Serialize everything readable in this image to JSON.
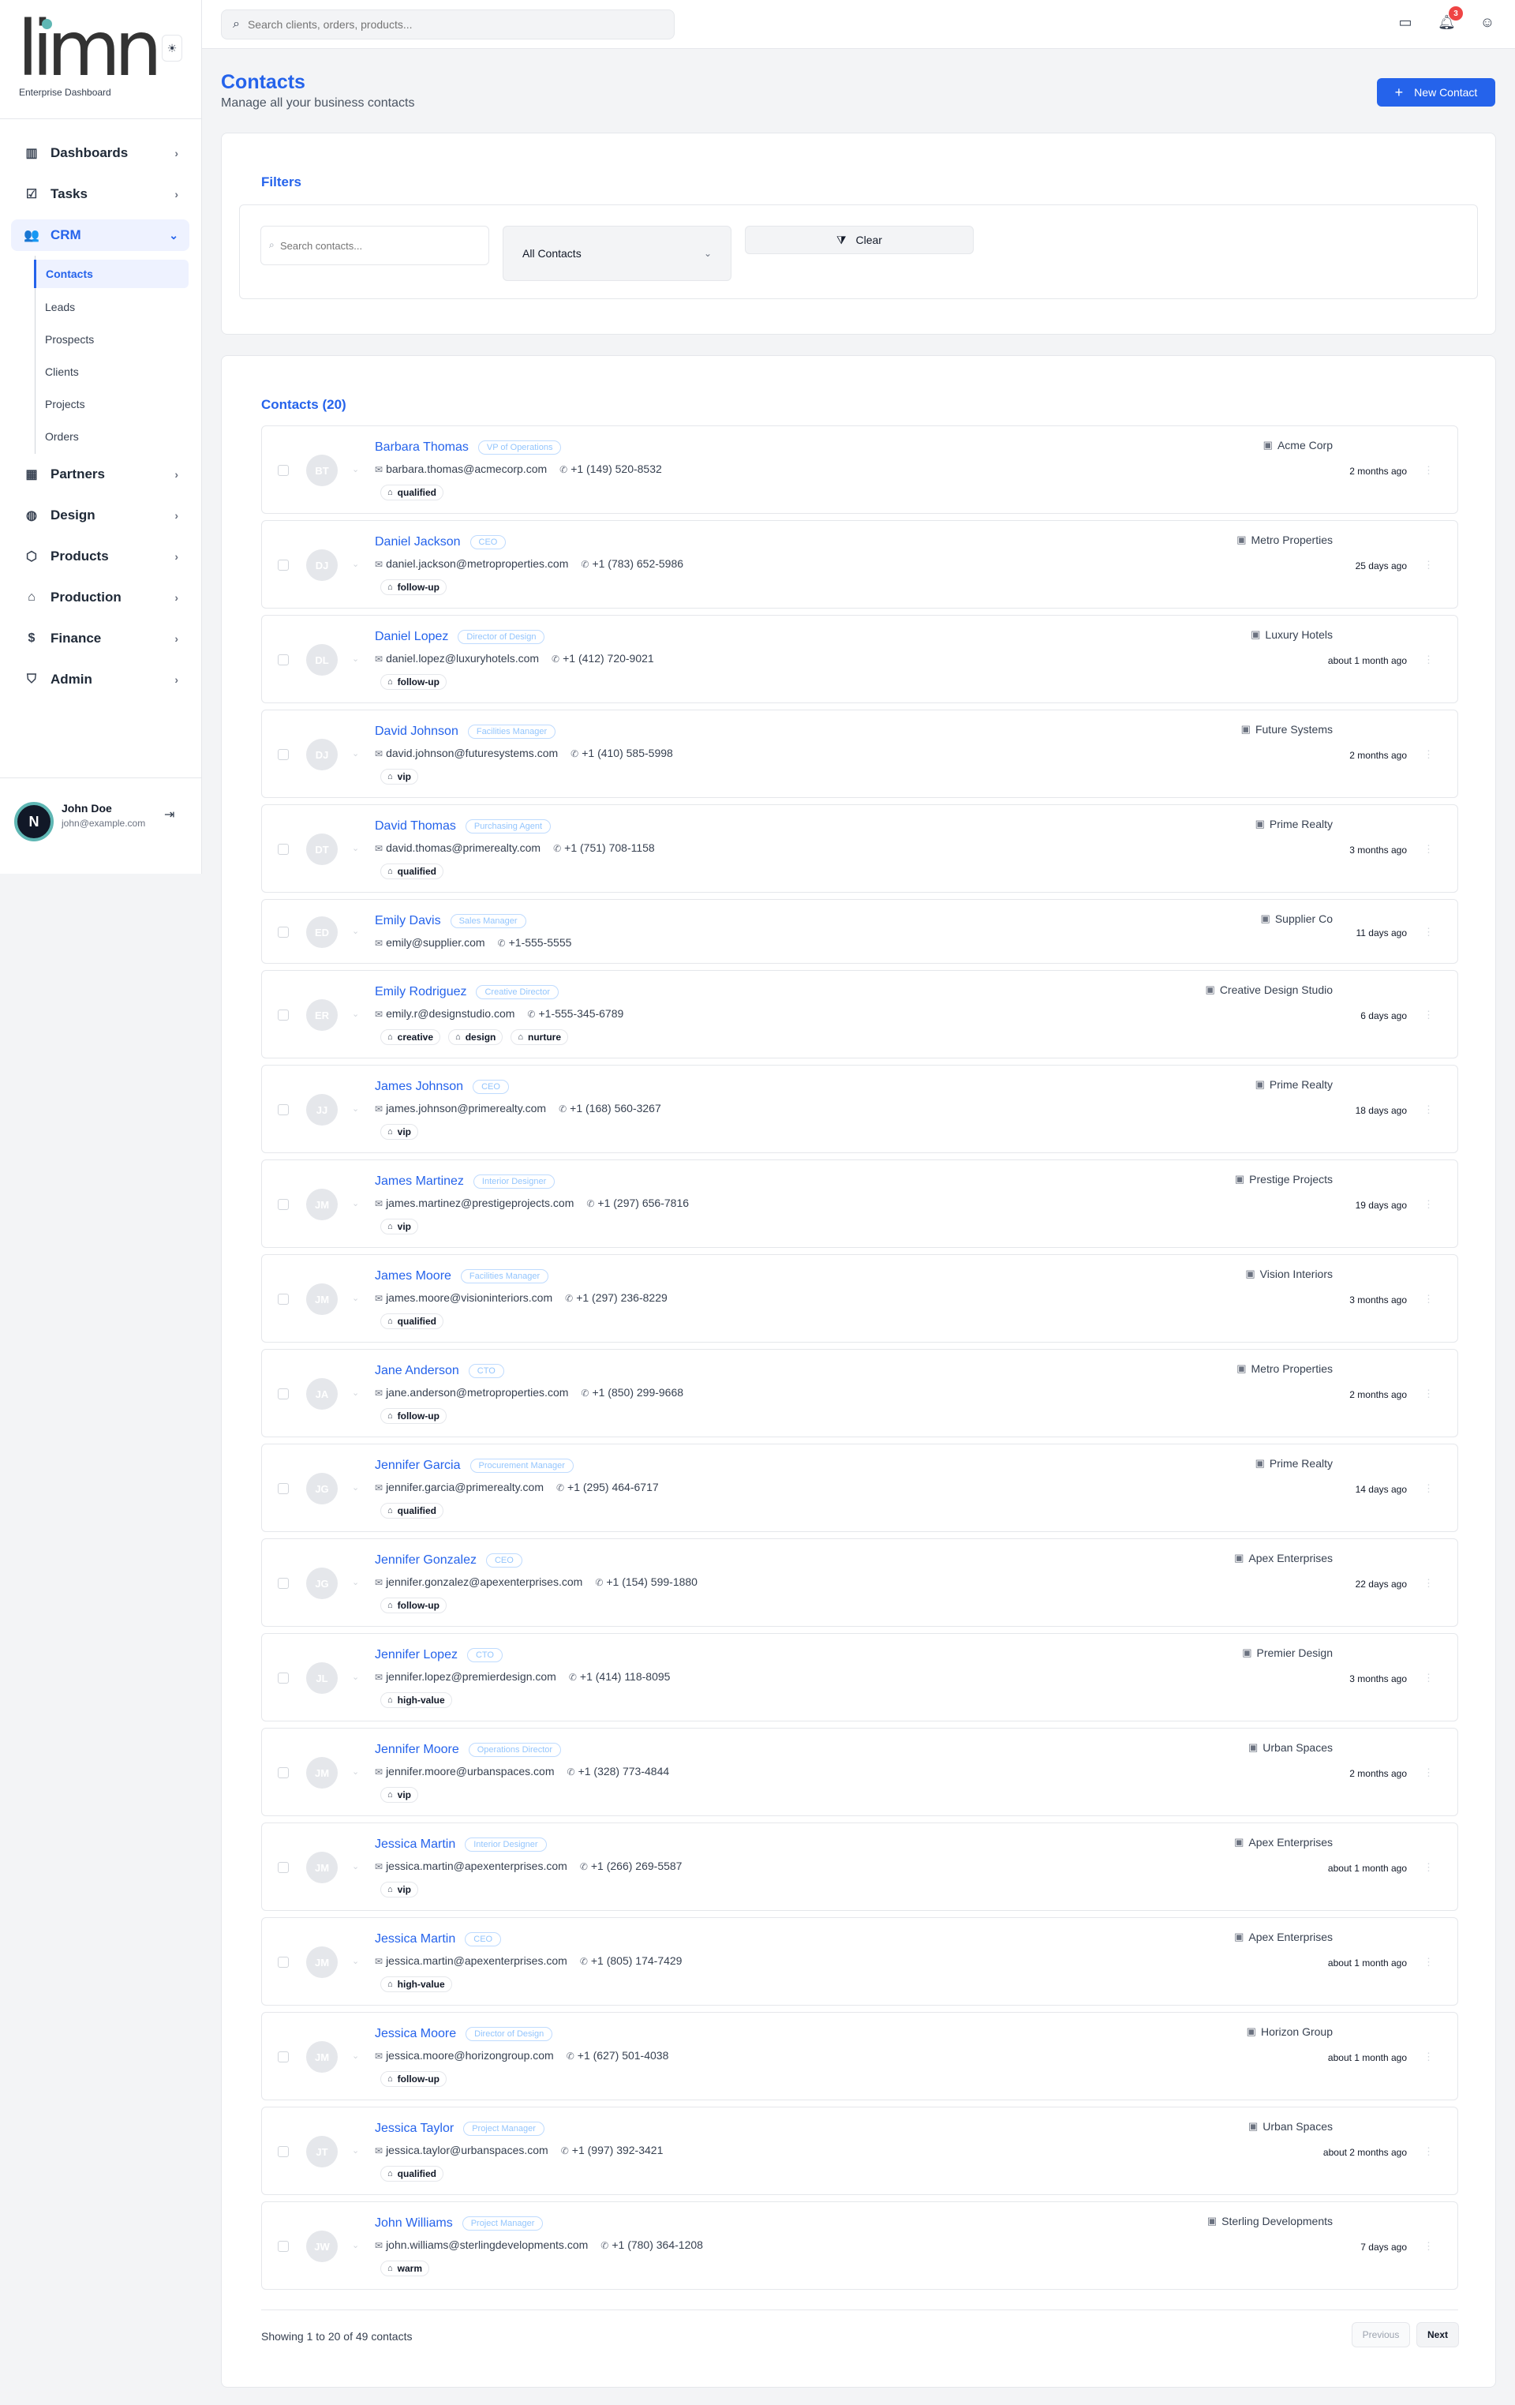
{
  "brand": {
    "logo_text": "limn",
    "subtitle": "Enterprise Dashboard",
    "theme_icon": "sun-icon"
  },
  "search": {
    "placeholder": "Search clients, orders, products..."
  },
  "header": {
    "notification_count": "3"
  },
  "sidebar": {
    "items": [
      {
        "label": "Dashboards",
        "icon": "bar-chart-icon"
      },
      {
        "label": "Tasks",
        "icon": "checkbox-icon"
      },
      {
        "label": "CRM",
        "icon": "users-icon",
        "active": true
      },
      {
        "label": "Partners",
        "icon": "building-icon"
      },
      {
        "label": "Design",
        "icon": "palette-icon"
      },
      {
        "label": "Products",
        "icon": "box-icon"
      },
      {
        "label": "Production",
        "icon": "factory-icon"
      },
      {
        "label": "Finance",
        "icon": "dollar-icon"
      },
      {
        "label": "Admin",
        "icon": "shield-icon"
      }
    ],
    "crm_sub": [
      "Contacts",
      "Leads",
      "Prospects",
      "Clients",
      "Projects",
      "Orders"
    ],
    "user": {
      "initial": "N",
      "name": "John Doe",
      "email": "john@example.com"
    }
  },
  "page": {
    "title": "Contacts",
    "subtitle": "Manage all your business contacts",
    "new_button": "New Contact"
  },
  "filters": {
    "title": "Filters",
    "search_placeholder": "Search contacts...",
    "select_value": "All Contacts",
    "clear_label": "Clear"
  },
  "contacts": {
    "title": "Contacts (20)",
    "rows": [
      {
        "initials": "BT",
        "name": "Barbara Thomas",
        "role": "VP of Operations",
        "email": "barbara.thomas@acmecorp.com",
        "phone": "+1 (149) 520-8532",
        "tags": [
          "qualified"
        ],
        "company": "Acme Corp",
        "time": "2 months ago"
      },
      {
        "initials": "DJ",
        "name": "Daniel Jackson",
        "role": "CEO",
        "email": "daniel.jackson@metroproperties.com",
        "phone": "+1 (783) 652-5986",
        "tags": [
          "follow-up"
        ],
        "company": "Metro Properties",
        "time": "25 days ago"
      },
      {
        "initials": "DL",
        "name": "Daniel Lopez",
        "role": "Director of Design",
        "email": "daniel.lopez@luxuryhotels.com",
        "phone": "+1 (412) 720-9021",
        "tags": [
          "follow-up"
        ],
        "company": "Luxury Hotels",
        "time": "about 1 month ago"
      },
      {
        "initials": "DJ",
        "name": "David Johnson",
        "role": "Facilities Manager",
        "email": "david.johnson@futuresystems.com",
        "phone": "+1 (410) 585-5998",
        "tags": [
          "vip"
        ],
        "company": "Future Systems",
        "time": "2 months ago"
      },
      {
        "initials": "DT",
        "name": "David Thomas",
        "role": "Purchasing Agent",
        "email": "david.thomas@primerealty.com",
        "phone": "+1 (751) 708-1158",
        "tags": [
          "qualified"
        ],
        "company": "Prime Realty",
        "time": "3 months ago"
      },
      {
        "initials": "ED",
        "name": "Emily Davis",
        "role": "Sales Manager",
        "email": "emily@supplier.com",
        "phone": "+1-555-5555",
        "tags": [],
        "company": "Supplier Co",
        "time": "11 days ago"
      },
      {
        "initials": "ER",
        "name": "Emily Rodriguez",
        "role": "Creative Director",
        "email": "emily.r@designstudio.com",
        "phone": "+1-555-345-6789",
        "tags": [
          "creative",
          "design",
          "nurture"
        ],
        "company": "Creative Design Studio",
        "time": "6 days ago"
      },
      {
        "initials": "JJ",
        "name": "James Johnson",
        "role": "CEO",
        "email": "james.johnson@primerealty.com",
        "phone": "+1 (168) 560-3267",
        "tags": [
          "vip"
        ],
        "company": "Prime Realty",
        "time": "18 days ago"
      },
      {
        "initials": "JM",
        "name": "James Martinez",
        "role": "Interior Designer",
        "email": "james.martinez@prestigeprojects.com",
        "phone": "+1 (297) 656-7816",
        "tags": [
          "vip"
        ],
        "company": "Prestige Projects",
        "time": "19 days ago"
      },
      {
        "initials": "JM",
        "name": "James Moore",
        "role": "Facilities Manager",
        "email": "james.moore@visioninteriors.com",
        "phone": "+1 (297) 236-8229",
        "tags": [
          "qualified"
        ],
        "company": "Vision Interiors",
        "time": "3 months ago"
      },
      {
        "initials": "JA",
        "name": "Jane Anderson",
        "role": "CTO",
        "email": "jane.anderson@metroproperties.com",
        "phone": "+1 (850) 299-9668",
        "tags": [
          "follow-up"
        ],
        "company": "Metro Properties",
        "time": "2 months ago"
      },
      {
        "initials": "JG",
        "name": "Jennifer Garcia",
        "role": "Procurement Manager",
        "email": "jennifer.garcia@primerealty.com",
        "phone": "+1 (295) 464-6717",
        "tags": [
          "qualified"
        ],
        "company": "Prime Realty",
        "time": "14 days ago"
      },
      {
        "initials": "JG",
        "name": "Jennifer Gonzalez",
        "role": "CEO",
        "email": "jennifer.gonzalez@apexenterprises.com",
        "phone": "+1 (154) 599-1880",
        "tags": [
          "follow-up"
        ],
        "company": "Apex Enterprises",
        "time": "22 days ago"
      },
      {
        "initials": "JL",
        "name": "Jennifer Lopez",
        "role": "CTO",
        "email": "jennifer.lopez@premierdesign.com",
        "phone": "+1 (414) 118-8095",
        "tags": [
          "high-value"
        ],
        "company": "Premier Design",
        "time": "3 months ago"
      },
      {
        "initials": "JM",
        "name": "Jennifer Moore",
        "role": "Operations Director",
        "email": "jennifer.moore@urbanspaces.com",
        "phone": "+1 (328) 773-4844",
        "tags": [
          "vip"
        ],
        "company": "Urban Spaces",
        "time": "2 months ago"
      },
      {
        "initials": "JM",
        "name": "Jessica Martin",
        "role": "Interior Designer",
        "email": "jessica.martin@apexenterprises.com",
        "phone": "+1 (266) 269-5587",
        "tags": [
          "vip"
        ],
        "company": "Apex Enterprises",
        "time": "about 1 month ago"
      },
      {
        "initials": "JM",
        "name": "Jessica Martin",
        "role": "CEO",
        "email": "jessica.martin@apexenterprises.com",
        "phone": "+1 (805) 174-7429",
        "tags": [
          "high-value"
        ],
        "company": "Apex Enterprises",
        "time": "about 1 month ago"
      },
      {
        "initials": "JM",
        "name": "Jessica Moore",
        "role": "Director of Design",
        "email": "jessica.moore@horizongroup.com",
        "phone": "+1 (627) 501-4038",
        "tags": [
          "follow-up"
        ],
        "company": "Horizon Group",
        "time": "about 1 month ago"
      },
      {
        "initials": "JT",
        "name": "Jessica Taylor",
        "role": "Project Manager",
        "email": "jessica.taylor@urbanspaces.com",
        "phone": "+1 (997) 392-3421",
        "tags": [
          "qualified"
        ],
        "company": "Urban Spaces",
        "time": "about 2 months ago"
      },
      {
        "initials": "JW",
        "name": "John Williams",
        "role": "Project Manager",
        "email": "john.williams@sterlingdevelopments.com",
        "phone": "+1 (780) 364-1208",
        "tags": [
          "warm"
        ],
        "company": "Sterling Developments",
        "time": "7 days ago"
      }
    ]
  },
  "pagination": {
    "showing": "Showing 1 to 20 of 49 contacts",
    "previous": "Previous",
    "next": "Next"
  },
  "colors": {
    "accent": "#2563eb",
    "badge": "#ef4444",
    "logo_dot": "#5fb7b4"
  }
}
